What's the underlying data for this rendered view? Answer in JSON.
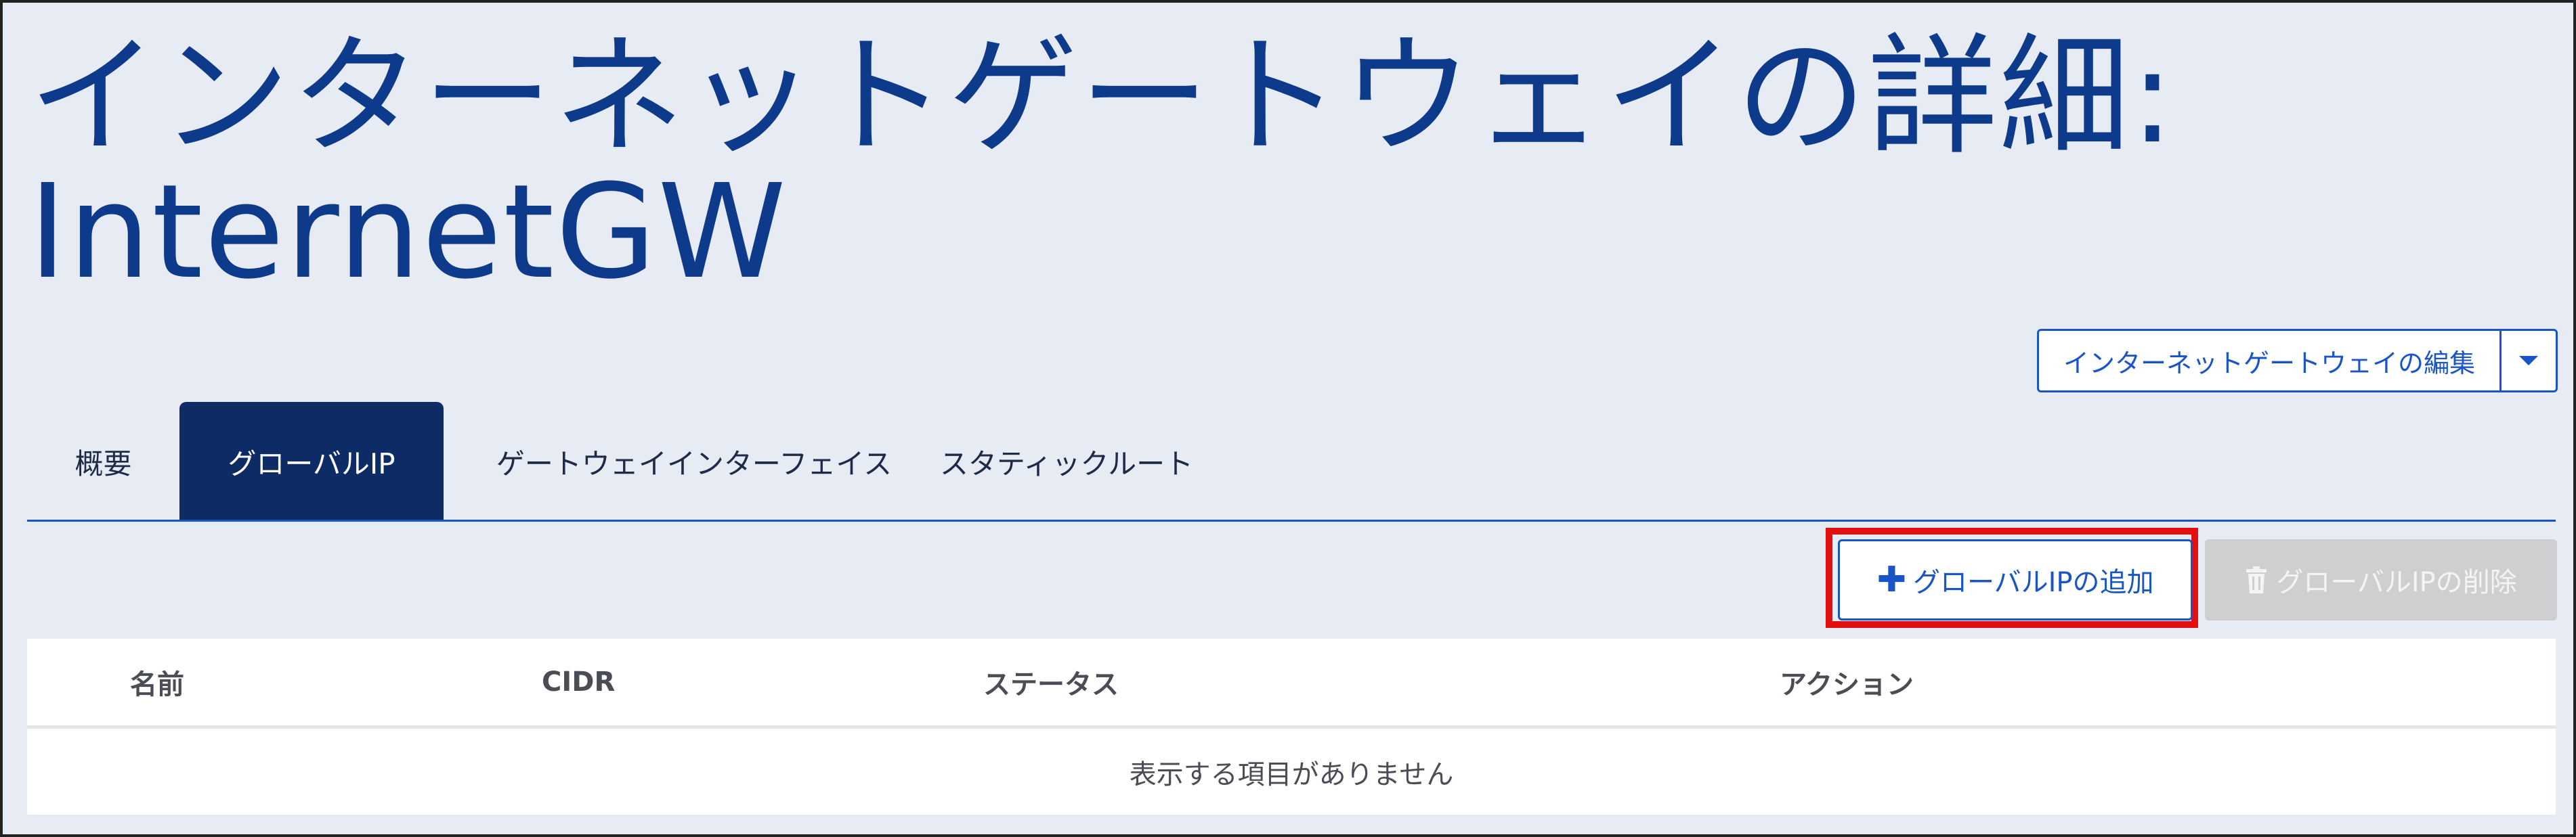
{
  "page": {
    "title_line1": "インターネットゲートウェイの詳細:",
    "title_line2": "InternetGW"
  },
  "actions": {
    "edit_label": "インターネットゲートウェイの編集",
    "edit_caret_icon": "caret-down-icon"
  },
  "tabs": [
    {
      "label": "概要",
      "active": false
    },
    {
      "label": "グローバルIP",
      "active": true
    },
    {
      "label": "ゲートウェイインターフェイス",
      "active": false
    },
    {
      "label": "スタティックルート",
      "active": false
    }
  ],
  "toolbar": {
    "add_label": "グローバルIPの追加",
    "add_icon": "plus-icon",
    "delete_label": "グローバルIPの削除",
    "delete_icon": "trash-icon",
    "delete_disabled": true
  },
  "table": {
    "columns": [
      "名前",
      "CIDR",
      "ステータス",
      "アクション"
    ],
    "empty_message": "表示する項目がありません"
  },
  "colors": {
    "title": "#0d3a8a",
    "accent": "#1a55c8",
    "active_tab": "#0d2c66",
    "highlight": "#e21010",
    "background": "#e7ebf4"
  }
}
